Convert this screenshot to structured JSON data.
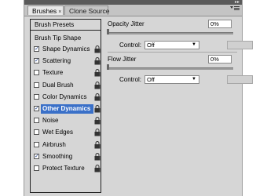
{
  "tabs": {
    "active": "Brushes",
    "inactive": "Clone Source",
    "close": "×"
  },
  "icons": {
    "collapse": "double-arrow-icon",
    "menu": "panel-menu-icon",
    "lock": "lock-icon",
    "check": "✓"
  },
  "left": {
    "presets": "Brush Presets",
    "tip_shape": "Brush Tip Shape",
    "options": [
      {
        "label": "Shape Dynamics",
        "checked": true,
        "selected": false
      },
      {
        "label": "Scattering",
        "checked": true,
        "selected": false
      },
      {
        "label": "Texture",
        "checked": false,
        "selected": false
      },
      {
        "label": "Dual Brush",
        "checked": false,
        "selected": false
      },
      {
        "label": "Color Dynamics",
        "checked": false,
        "selected": false
      },
      {
        "label": "Other Dynamics",
        "checked": true,
        "selected": true
      },
      {
        "label": "Noise",
        "checked": false,
        "selected": false
      },
      {
        "label": "Wet Edges",
        "checked": false,
        "selected": false
      },
      {
        "label": "Airbrush",
        "checked": false,
        "selected": false
      },
      {
        "label": "Smoothing",
        "checked": true,
        "selected": false
      },
      {
        "label": "Protect Texture",
        "checked": false,
        "selected": false
      }
    ]
  },
  "right": {
    "opacity_label": "Opacity Jitter",
    "opacity_value": "0%",
    "opacity_control_label": "Control:",
    "opacity_control_value": "Off",
    "flow_label": "Flow Jitter",
    "flow_value": "0%",
    "flow_control_label": "Control:",
    "flow_control_value": "Off"
  },
  "colors": {
    "selection": "#3a70c8",
    "panel": "#d6d6d6"
  }
}
